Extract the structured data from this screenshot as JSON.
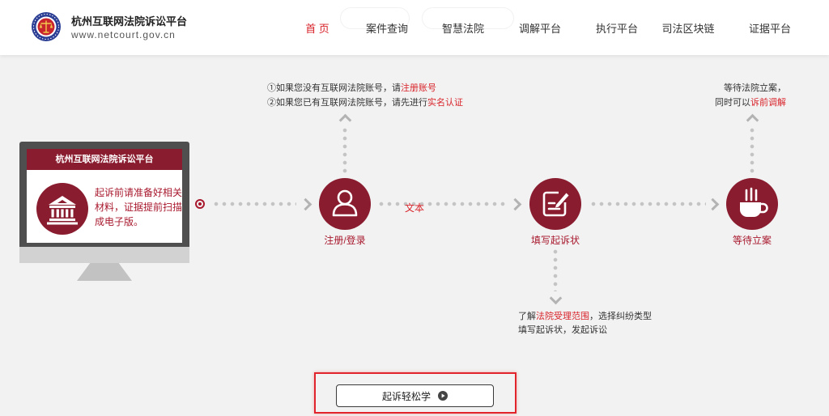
{
  "header": {
    "title": "杭州互联网法院诉讼平台",
    "url": "www.netcourt.gov.cn",
    "logo_icon": "court-emblem-icon",
    "nav": [
      {
        "label": "首 页",
        "active": true
      },
      {
        "label": "案件查询"
      },
      {
        "label": "智慧法院"
      },
      {
        "label": "调解平台"
      },
      {
        "label": "执行平台"
      },
      {
        "label": "司法区块链"
      },
      {
        "label": "证据平台"
      }
    ]
  },
  "monitor": {
    "title": "杭州互联网法院诉讼平台",
    "icon": "courthouse-icon",
    "lines": [
      "起诉前请准备好相关",
      "材料，证据提前扫描",
      "成电子版。"
    ]
  },
  "flow": {
    "connector_text": "文本",
    "steps": [
      {
        "label": "注册/登录",
        "icon": "user-icon"
      },
      {
        "label": "填写起诉状",
        "icon": "edit-document-icon"
      },
      {
        "label": "等待立案",
        "icon": "coffee-cup-icon"
      }
    ]
  },
  "notes": {
    "register": [
      {
        "text": "①如果您没有互联网法院账号，请",
        "link": "注册账号"
      },
      {
        "text": "②如果您已有互联网法院账号，请先进行",
        "link": "实名认证"
      }
    ],
    "file_complaint": [
      {
        "before": "了解",
        "link": "法院受理范围",
        "after": "，选择纠纷类型"
      },
      {
        "text": "填写起诉状，发起诉讼"
      }
    ],
    "await_filing": [
      {
        "text": "等待法院立案，"
      },
      {
        "text": "同时可以",
        "link": "诉前调解"
      }
    ]
  },
  "learn_button": {
    "label": "起诉轻松学",
    "icon": "play-circle-icon"
  },
  "colors": {
    "accent": "#8a1c2f",
    "label_red": "#a8192e",
    "link_red": "#d8232a",
    "highlight": "#e1242b"
  }
}
